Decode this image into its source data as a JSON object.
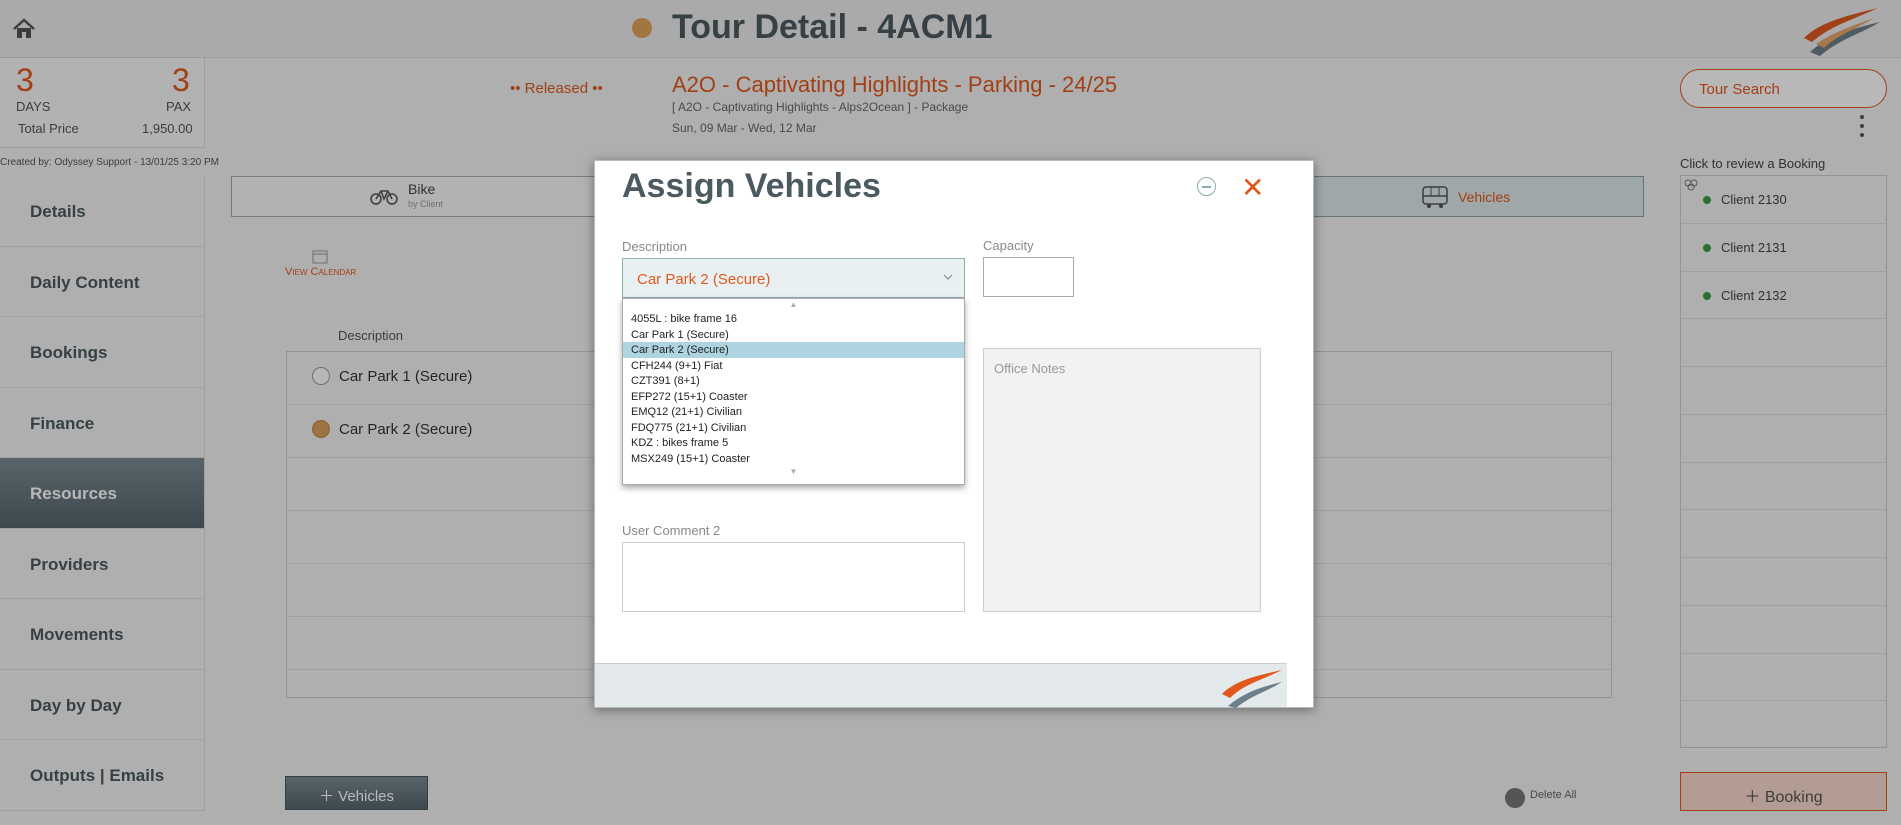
{
  "header": {
    "title": "Tour Detail - 4ACM1"
  },
  "summary": {
    "days_value": "3",
    "days_label": "DAYS",
    "pax_value": "3",
    "pax_label": "PAX",
    "total_price_label": "Total Price",
    "total_price_value": "1,950.00",
    "created_by": "Created by: Odyssey Support - 13/01/25 3:20 PM"
  },
  "tour": {
    "status": "•• Released ••",
    "name": "A2O - Captivating Highlights - Parking - 24/25",
    "subtitle": "[ A2O - Captivating Highlights - Alps2Ocean ] - Package",
    "dates": "Sun, 09 Mar  - Wed, 12 Mar"
  },
  "search": {
    "label": "Tour Search"
  },
  "nav": {
    "items": [
      {
        "label": "Details"
      },
      {
        "label": "Daily Content"
      },
      {
        "label": "Bookings"
      },
      {
        "label": "Finance"
      },
      {
        "label": "Resources"
      },
      {
        "label": "Providers"
      },
      {
        "label": "Movements"
      },
      {
        "label": "Day by Day"
      },
      {
        "label": "Outputs | Emails"
      }
    ],
    "active": "Resources"
  },
  "tabs": {
    "bike_label": "Bike",
    "bike_sub": "by Client",
    "vehicles_label": "Vehicles"
  },
  "main": {
    "view_calendar": "View Calendar",
    "description_header": "Description",
    "rows": [
      {
        "label": "Car Park 1 (Secure)",
        "selected": false
      },
      {
        "label": "Car Park 2 (Secure)",
        "selected": true
      }
    ],
    "add_vehicles": "Vehicles",
    "delete_all": "Delete All"
  },
  "right": {
    "review_label": "Click to review a Booking",
    "clients": [
      {
        "name": "Client 2130"
      },
      {
        "name": "Client 2131"
      },
      {
        "name": "Client 2132"
      }
    ],
    "booking_button": "Booking"
  },
  "modal": {
    "title": "Assign Vehicles",
    "description_label": "Description",
    "description_value": "Car Park 2 (Secure)",
    "capacity_label": "Capacity",
    "office_notes_placeholder": "Office Notes",
    "user_comment2_label": "User Comment 2",
    "options": [
      "4055L : bike frame 16",
      "Car Park 1 (Secure)",
      "Car Park 2 (Secure)",
      "CFH244 (9+1) Fiat",
      "CZT391 (8+1)",
      "EFP272 (15+1) Coaster",
      "EMQ12 (21+1) Civilian",
      "FDQ775 (21+1) Civilian",
      "KDZ : bikes frame 5",
      "MSX249 (15+1) Coaster"
    ],
    "selected_option": "Car Park 2 (Secure)"
  },
  "colors": {
    "accent": "#e0581f",
    "slate": "#4b5960",
    "status_dot": "#e0a55a",
    "client_dot": "#3c9a3c"
  }
}
